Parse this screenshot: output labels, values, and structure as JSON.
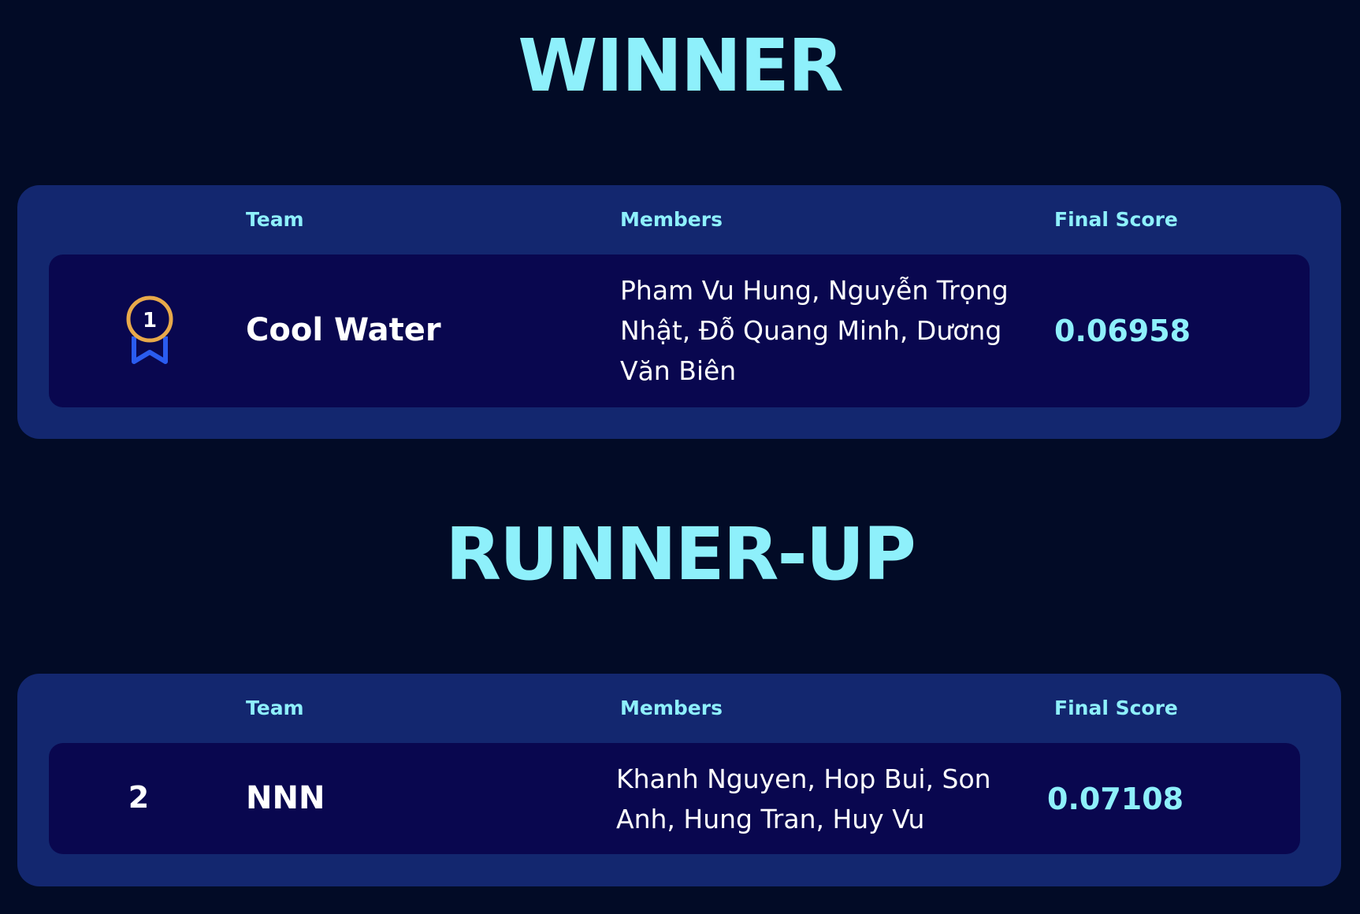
{
  "sections": {
    "winner": {
      "title": "WINNER",
      "headers": {
        "team": "Team",
        "members": "Members",
        "score": "Final Score"
      },
      "row": {
        "rank": "1",
        "rank_icon": "medal-ribbon-icon",
        "team": "Cool Water",
        "members": "Pham Vu Hung, Nguyễn Trọng Nhật, Đỗ Quang Minh, Dương Văn Biên",
        "score": "0.06958"
      }
    },
    "runnerup": {
      "title": "RUNNER-UP",
      "headers": {
        "team": "Team",
        "members": "Members",
        "score": "Final Score"
      },
      "row": {
        "rank": "2",
        "team": "NNN",
        "members": "Khanh Nguyen, Hop Bui, Son Anh, Hung Tran, Huy Vu",
        "score": "0.07108"
      }
    }
  },
  "colors": {
    "background": "#020b26",
    "panel": "#13276f",
    "row": "#09074f",
    "accent": "#8ef0fb",
    "medal_gold": "#e8a94a",
    "ribbon_blue": "#2a5cf0"
  }
}
